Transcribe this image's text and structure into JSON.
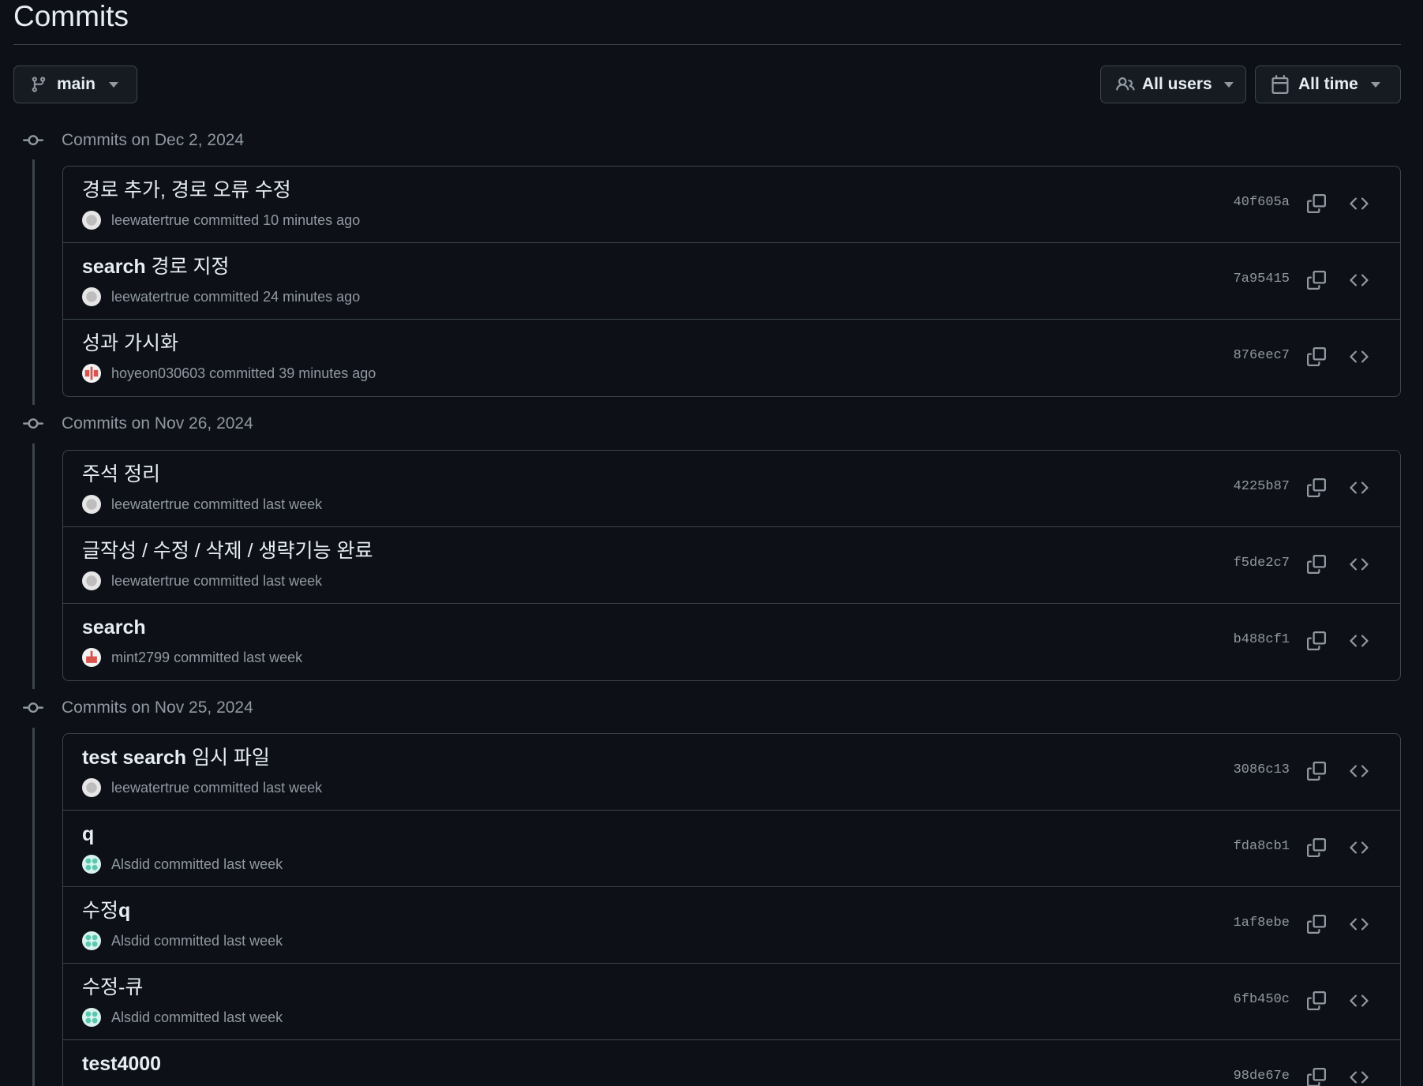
{
  "page": {
    "title": "Commits"
  },
  "toolbar": {
    "branch_label": "main",
    "users_label": "All users",
    "time_label": "All time"
  },
  "groups": [
    {
      "title": "Commits on Dec 2, 2024",
      "commits": [
        {
          "message": "경로 추가, 경로 오류 수정",
          "author": "leewatertrue",
          "verb": "committed",
          "time": "10 minutes ago",
          "sha": "40f605a",
          "avatar": "gray"
        },
        {
          "message": "search 경로 지정",
          "message_bold": "search",
          "message_rest": " 경로 지정",
          "author": "leewatertrue",
          "verb": "committed",
          "time": "24 minutes ago",
          "sha": "7a95415",
          "avatar": "gray"
        },
        {
          "message": "성과 가시화",
          "author": "hoyeon030603",
          "verb": "committed",
          "time": "39 minutes ago",
          "sha": "876eec7",
          "avatar": "red"
        }
      ]
    },
    {
      "title": "Commits on Nov 26, 2024",
      "commits": [
        {
          "message": "주석 정리",
          "author": "leewatertrue",
          "verb": "committed",
          "time": "last week",
          "sha": "4225b87",
          "avatar": "gray"
        },
        {
          "message": "글작성 / 수정 / 삭제 / 생략기능 완료",
          "author": "leewatertrue",
          "verb": "committed",
          "time": "last week",
          "sha": "f5de2c7",
          "avatar": "gray"
        },
        {
          "message": "search",
          "message_bold": "search",
          "message_rest": "",
          "author": "mint2799",
          "verb": "committed",
          "time": "last week",
          "sha": "b488cf1",
          "avatar": "red2"
        }
      ]
    },
    {
      "title": "Commits on Nov 25, 2024",
      "commits": [
        {
          "message": "test search 임시 파일",
          "message_bold": "test search",
          "message_rest": " 임시 파일",
          "author": "leewatertrue",
          "verb": "committed",
          "time": "last week",
          "sha": "3086c13",
          "avatar": "gray"
        },
        {
          "message": "q",
          "message_bold": "q",
          "message_rest": "",
          "author": "Alsdid",
          "verb": "committed",
          "time": "last week",
          "sha": "fda8cb1",
          "avatar": "teal"
        },
        {
          "message": "수정q",
          "message_bold": "q",
          "message_prefix": "수정",
          "author": "Alsdid",
          "verb": "committed",
          "time": "last week",
          "sha": "1af8ebe",
          "avatar": "teal"
        },
        {
          "message": "수정-큐",
          "author": "Alsdid",
          "verb": "committed",
          "time": "last week",
          "sha": "6fb450c",
          "avatar": "teal"
        },
        {
          "message": "test4000",
          "message_bold": "test4000",
          "message_rest": "",
          "author": "",
          "verb": "",
          "time": "",
          "sha": "98de67e",
          "avatar": ""
        }
      ]
    }
  ],
  "colors": {
    "background": "#0d1117",
    "border": "#3d444d",
    "muted": "#9198a1",
    "text": "#e6edf3"
  }
}
